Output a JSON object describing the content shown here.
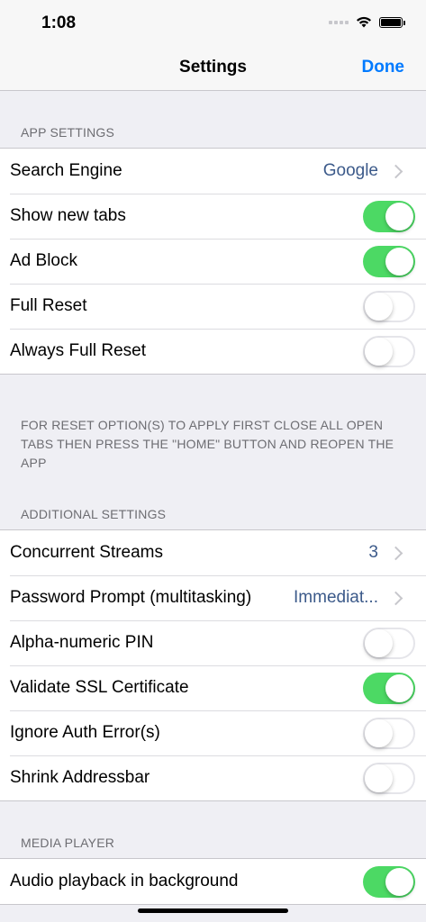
{
  "status": {
    "time": "1:08"
  },
  "nav": {
    "title": "Settings",
    "done_label": "Done"
  },
  "app_settings": {
    "header": "APP SETTINGS",
    "search_engine": {
      "label": "Search Engine",
      "value": "Google"
    },
    "show_new_tabs": {
      "label": "Show new tabs",
      "on": true
    },
    "ad_block": {
      "label": "Ad Block",
      "on": true
    },
    "full_reset": {
      "label": "Full Reset",
      "on": false
    },
    "always_full_reset": {
      "label": "Always Full Reset",
      "on": false
    },
    "footer": "FOR RESET OPTION(S) TO APPLY FIRST CLOSE ALL OPEN TABS THEN PRESS THE \"HOME\" BUTTON AND REOPEN THE APP"
  },
  "additional_settings": {
    "header": "ADDITIONAL SETTINGS",
    "concurrent_streams": {
      "label": "Concurrent Streams",
      "value": "3"
    },
    "password_prompt": {
      "label": "Password Prompt (multitasking)",
      "value": "Immediat..."
    },
    "alpha_numeric_pin": {
      "label": "Alpha-numeric PIN",
      "on": false
    },
    "validate_ssl": {
      "label": "Validate SSL Certificate",
      "on": true
    },
    "ignore_auth_error": {
      "label": "Ignore Auth Error(s)",
      "on": false
    },
    "shrink_addressbar": {
      "label": "Shrink Addressbar",
      "on": false
    }
  },
  "media_player": {
    "header": "MEDIA PLAYER",
    "audio_background": {
      "label": "Audio playback in background",
      "on": true
    }
  },
  "colors": {
    "accent": "#007aff",
    "toggle_on": "#4cd964",
    "value_text": "#3c5a8a"
  },
  "icons": [
    "signal-icon",
    "wifi-icon",
    "battery-icon",
    "chevron-right-icon"
  ]
}
